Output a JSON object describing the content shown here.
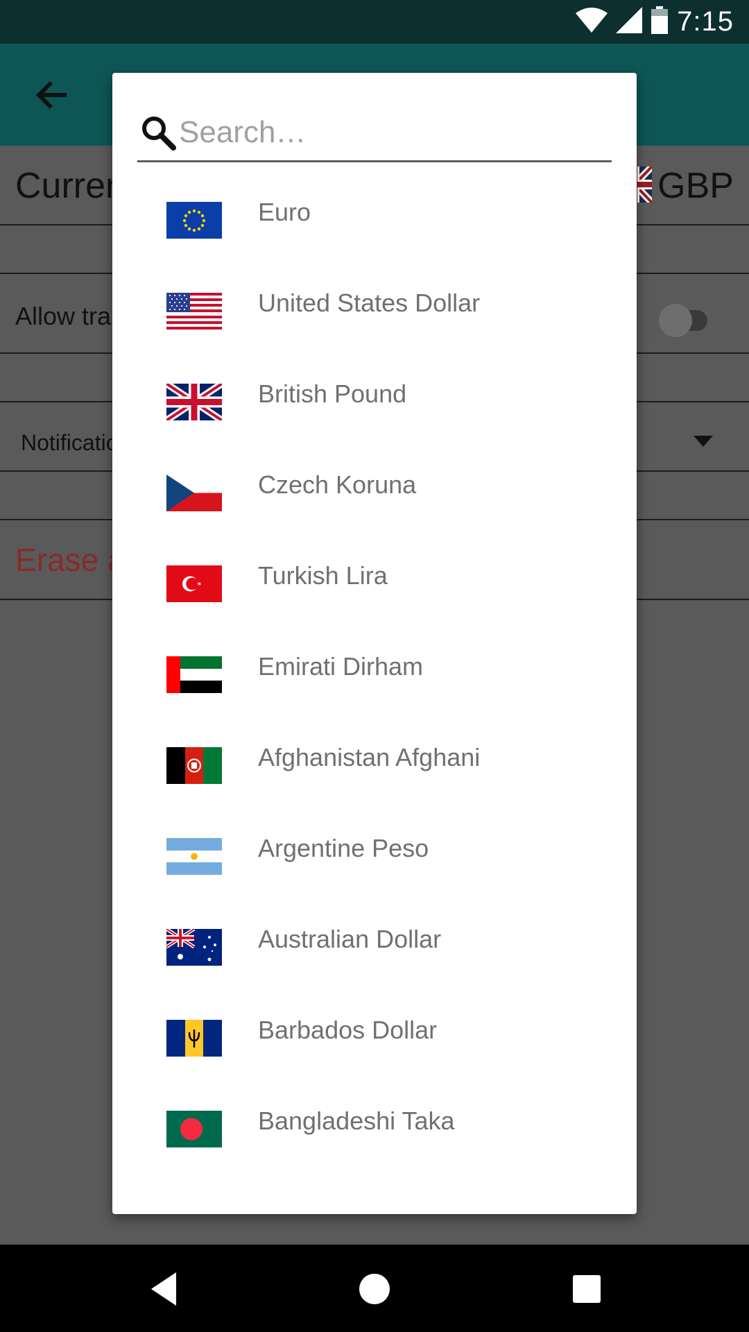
{
  "status_bar": {
    "time": "7:15",
    "icons": [
      "wifi-icon",
      "cellular-signal-icon",
      "battery-icon"
    ]
  },
  "app_bar": {
    "back_icon": "arrow-back-icon",
    "background": "#0e5656"
  },
  "settings": {
    "currency_label": "Currency",
    "currency_value": "GBP",
    "allow_label": "Allow transactions",
    "notification_label": "Notifications",
    "erase_label": "Erase all data"
  },
  "dialog": {
    "search": {
      "placeholder": "Search…",
      "value": ""
    },
    "currencies": [
      {
        "name": "Euro",
        "flag": "eu-flag-icon"
      },
      {
        "name": "United States Dollar",
        "flag": "us-flag-icon"
      },
      {
        "name": "British Pound",
        "flag": "gb-flag-icon"
      },
      {
        "name": "Czech Koruna",
        "flag": "cz-flag-icon"
      },
      {
        "name": "Turkish Lira",
        "flag": "tr-flag-icon"
      },
      {
        "name": "Emirati Dirham",
        "flag": "ae-flag-icon"
      },
      {
        "name": "Afghanistan Afghani",
        "flag": "af-flag-icon"
      },
      {
        "name": "Argentine Peso",
        "flag": "ar-flag-icon"
      },
      {
        "name": "Australian Dollar",
        "flag": "au-flag-icon"
      },
      {
        "name": "Barbados Dollar",
        "flag": "bb-flag-icon"
      },
      {
        "name": "Bangladeshi Taka",
        "flag": "bd-flag-icon"
      }
    ]
  },
  "nav_bar": {
    "buttons": [
      "back-triangle-icon",
      "home-circle-icon",
      "recents-square-icon"
    ]
  }
}
